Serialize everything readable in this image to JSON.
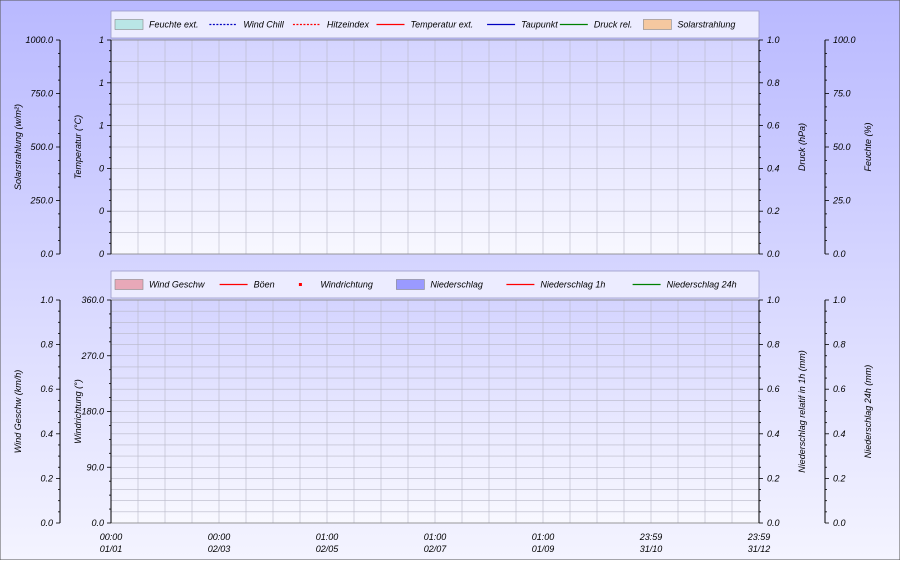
{
  "colors": {
    "bg_top": "#b9b9ff",
    "bg_bottom": "#f4f4ff",
    "plot_top": "#d4d4ff",
    "plot_bottom": "#f8f8ff",
    "grid": "#b8b8c8",
    "legend_bg": "#ececff"
  },
  "chart_data": [
    {
      "type": "line",
      "title": "",
      "legend": {
        "placement": "top",
        "items": [
          {
            "name": "Feuchte ext.",
            "style": "area",
            "color": "#b9e6e6"
          },
          {
            "name": "Wind Chill",
            "style": "dotted",
            "color": "#0000c0"
          },
          {
            "name": "Hitzeindex",
            "style": "dotted",
            "color": "#ff0000"
          },
          {
            "name": "Temperatur ext.",
            "style": "line",
            "color": "#ff0000"
          },
          {
            "name": "Taupunkt",
            "style": "line",
            "color": "#0000c0"
          },
          {
            "name": "Druck rel.",
            "style": "line",
            "color": "#008000"
          },
          {
            "name": "Solarstrahlung",
            "style": "area",
            "color": "#f5c8a0"
          }
        ]
      },
      "axes": {
        "left_outer": {
          "label": "Solarstrahlung (w/m²)",
          "ticks": [
            "0.0",
            "250.0",
            "500.0",
            "750.0",
            "1000.0"
          ]
        },
        "left_inner": {
          "label": "Temperatur (°C)",
          "ticks": [
            "0",
            "0",
            "0",
            "1",
            "1",
            "1"
          ]
        },
        "right_inner": {
          "label": "Druck (hPa)",
          "ticks": [
            "0.0",
            "0.2",
            "0.4",
            "0.6",
            "0.8",
            "1.0"
          ]
        },
        "right_outer": {
          "label": "Feuchte (%)",
          "ticks": [
            "0.0",
            "25.0",
            "50.0",
            "75.0",
            "100.0"
          ]
        }
      },
      "grid": true,
      "series": []
    },
    {
      "type": "line",
      "title": "",
      "legend": {
        "placement": "top",
        "items": [
          {
            "name": "Wind Geschw",
            "style": "area",
            "color": "#e8a8b8"
          },
          {
            "name": "Böen",
            "style": "line",
            "color": "#ff0000"
          },
          {
            "name": "Windrichtung",
            "style": "dot",
            "color": "#ff0000"
          },
          {
            "name": "Niederschlag",
            "style": "area",
            "color": "#9a9aff"
          },
          {
            "name": "Niederschlag 1h",
            "style": "line",
            "color": "#ff0000"
          },
          {
            "name": "Niederschlag 24h",
            "style": "line",
            "color": "#008000"
          }
        ]
      },
      "axes": {
        "left_outer": {
          "label": "Wind Geschw (km/h)",
          "ticks": [
            "0.0",
            "0.2",
            "0.4",
            "0.6",
            "0.8",
            "1.0"
          ]
        },
        "left_inner": {
          "label": "Windrichtung (°)",
          "ticks": [
            "0.0",
            "90.0",
            "180.0",
            "270.0",
            "360.0"
          ]
        },
        "right_inner": {
          "label": "Niederschlag relatif in 1h (mm)",
          "ticks": [
            "0.0",
            "0.2",
            "0.4",
            "0.6",
            "0.8",
            "1.0"
          ]
        },
        "right_outer": {
          "label": "Niederschlag 24h (mm)",
          "ticks": [
            "0.0",
            "0.2",
            "0.4",
            "0.6",
            "0.8",
            "1.0"
          ]
        }
      },
      "grid": true,
      "series": []
    }
  ],
  "x_axis": {
    "ticks": [
      {
        "time": "00:00",
        "date": "01/01"
      },
      {
        "time": "00:00",
        "date": "02/03"
      },
      {
        "time": "01:00",
        "date": "02/05"
      },
      {
        "time": "01:00",
        "date": "02/07"
      },
      {
        "time": "01:00",
        "date": "01/09"
      },
      {
        "time": "23:59",
        "date": "31/10"
      },
      {
        "time": "23:59",
        "date": "31/12"
      }
    ]
  }
}
